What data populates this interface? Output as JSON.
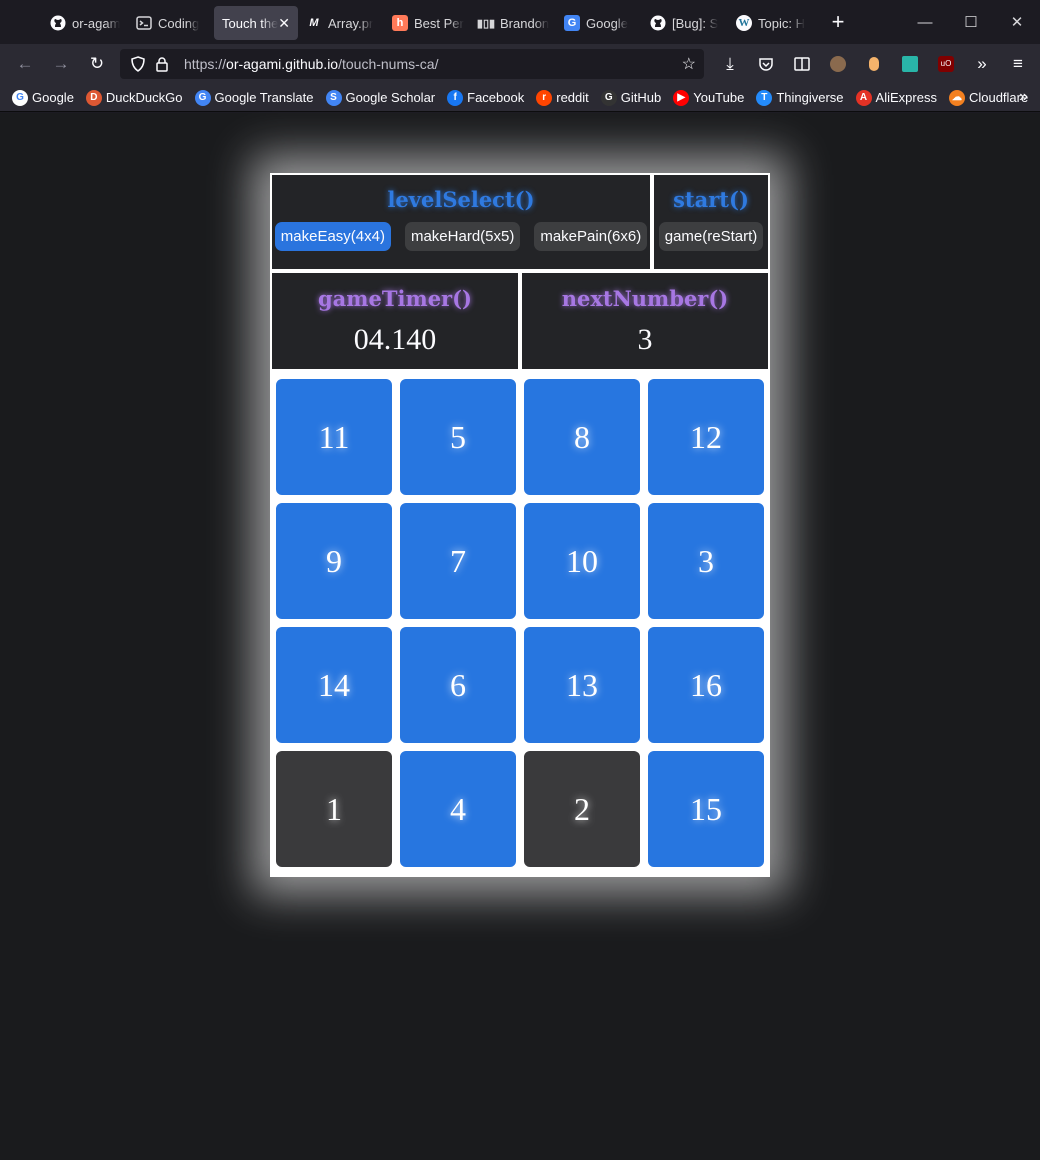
{
  "browser": {
    "tabs": [
      {
        "label": "or-agam",
        "icon": "github-icon",
        "active": false
      },
      {
        "label": "Coding",
        "icon": "terminal-icon",
        "active": false
      },
      {
        "label": "Touch the",
        "icon": "",
        "active": true
      },
      {
        "label": "Array.pr",
        "icon": "medium-icon",
        "active": false
      },
      {
        "label": "Best Per",
        "icon": "hubspot-icon",
        "active": false
      },
      {
        "label": "Brandon",
        "icon": "bars-icon",
        "active": false
      },
      {
        "label": "Google",
        "icon": "google-translate-icon",
        "active": false
      },
      {
        "label": "[Bug]: S",
        "icon": "github-icon",
        "active": false
      },
      {
        "label": "Topic: H",
        "icon": "wordpress-icon",
        "active": false
      }
    ],
    "url_prefix": "https://",
    "url_host": "or-agami.github.io",
    "url_path": "/touch-nums-ca/",
    "bookmarks": [
      {
        "label": "Google",
        "color": "#ffffff",
        "glyph": "G"
      },
      {
        "label": "DuckDuckGo",
        "color": "#de5833",
        "glyph": "D"
      },
      {
        "label": "Google Translate",
        "color": "#4285f4",
        "glyph": "G"
      },
      {
        "label": "Google Scholar",
        "color": "#4285f4",
        "glyph": "S"
      },
      {
        "label": "Facebook",
        "color": "#1877f2",
        "glyph": "f"
      },
      {
        "label": "reddit",
        "color": "#ff4500",
        "glyph": "r"
      },
      {
        "label": "GitHub",
        "color": "#333333",
        "glyph": "G"
      },
      {
        "label": "YouTube",
        "color": "#ff0000",
        "glyph": "▶"
      },
      {
        "label": "Thingiverse",
        "color": "#248bfb",
        "glyph": "T"
      },
      {
        "label": "AliExpress",
        "color": "#e43225",
        "glyph": "A"
      },
      {
        "label": "Cloudflare",
        "color": "#f38020",
        "glyph": "☁"
      }
    ]
  },
  "game": {
    "level_title": "levelSelect()",
    "start_title": "start()",
    "level_buttons": [
      "makeEasy(4x4)",
      "makeHard(5x5)",
      "makePain(6x6)"
    ],
    "selected_level": "makeEasy(4x4)",
    "restart_label": "game(reStart)",
    "timer_title": "gameTimer()",
    "timer_value": "04.140",
    "next_title": "nextNumber()",
    "next_value": "3",
    "grid": [
      {
        "n": "11",
        "done": false
      },
      {
        "n": "5",
        "done": false
      },
      {
        "n": "8",
        "done": false
      },
      {
        "n": "12",
        "done": false
      },
      {
        "n": "9",
        "done": false
      },
      {
        "n": "7",
        "done": false
      },
      {
        "n": "10",
        "done": false
      },
      {
        "n": "3",
        "done": false
      },
      {
        "n": "14",
        "done": false
      },
      {
        "n": "6",
        "done": false
      },
      {
        "n": "13",
        "done": false
      },
      {
        "n": "16",
        "done": false
      },
      {
        "n": "1",
        "done": true
      },
      {
        "n": "4",
        "done": false
      },
      {
        "n": "2",
        "done": true
      },
      {
        "n": "15",
        "done": false
      }
    ],
    "colors": {
      "tile": "#2776e0",
      "tile_done": "#3a3a3c",
      "title_blue": "#2f7ae0",
      "title_purple": "#a777e3"
    }
  }
}
